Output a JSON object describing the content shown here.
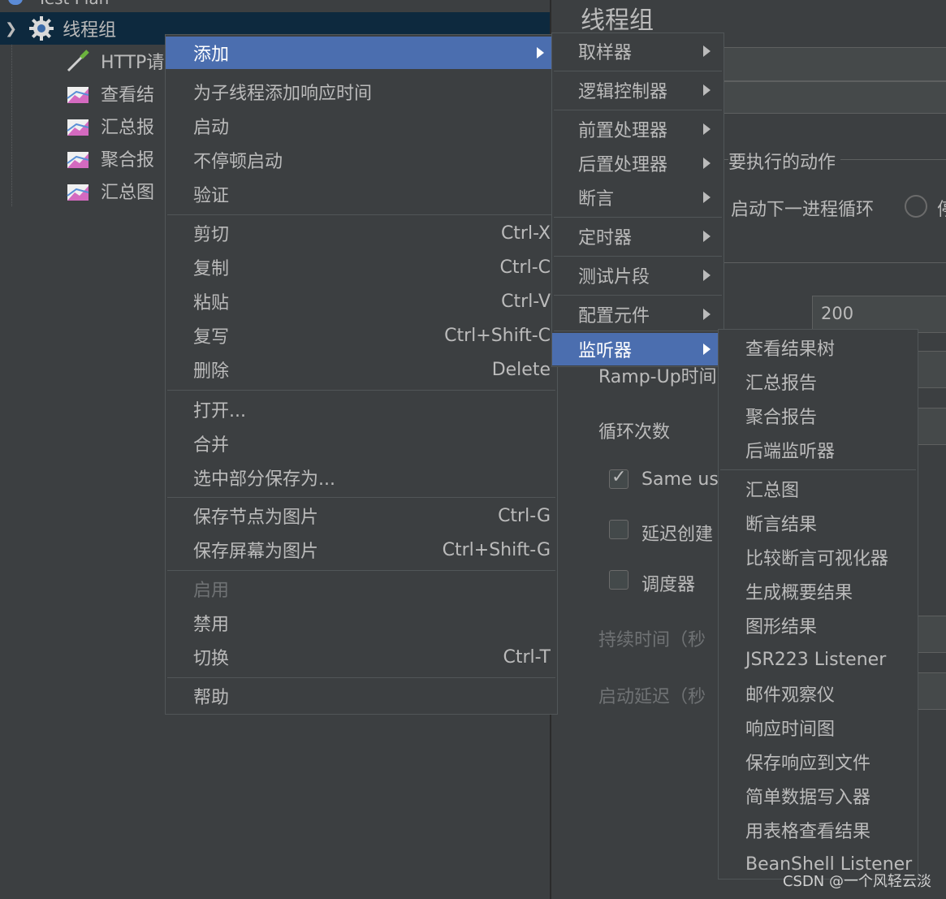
{
  "tree": {
    "top_partial": "Test Plan",
    "thread_group": "线程组",
    "children": [
      "HTTP请",
      "查看结",
      "汇总报",
      "聚合报",
      "汇总图"
    ]
  },
  "panel": {
    "title": "线程组",
    "action_label": "要执行的动作",
    "next_loop_label": "启动下一进程循环",
    "radio_trailing": "停",
    "threads_value": "200",
    "ramp_up_label": "Ramp-Up时间",
    "loop_label": "循环次数",
    "same_user_label": "Same use",
    "delay_create_label": "延迟创建",
    "scheduler_label": "调度器",
    "duration_label": "持续时间（秒",
    "startup_delay_label": "启动延迟（秒"
  },
  "context_menu": {
    "groups": [
      [
        {
          "label": "添加",
          "submenu": true,
          "active": true
        },
        {
          "label": "为子线程添加响应时间"
        },
        {
          "label": "启动"
        },
        {
          "label": "不停顿启动"
        },
        {
          "label": "验证"
        }
      ],
      [
        {
          "label": "剪切",
          "shortcut": "Ctrl-X"
        },
        {
          "label": "复制",
          "shortcut": "Ctrl-C"
        },
        {
          "label": "粘贴",
          "shortcut": "Ctrl-V"
        },
        {
          "label": "复写",
          "shortcut": "Ctrl+Shift-C"
        },
        {
          "label": "删除",
          "shortcut": "Delete"
        }
      ],
      [
        {
          "label": "打开..."
        },
        {
          "label": "合并"
        },
        {
          "label": "选中部分保存为..."
        }
      ],
      [
        {
          "label": "保存节点为图片",
          "shortcut": "Ctrl-G"
        },
        {
          "label": "保存屏幕为图片",
          "shortcut": "Ctrl+Shift-G"
        }
      ],
      [
        {
          "label": "启用",
          "disabled": true
        },
        {
          "label": "禁用"
        },
        {
          "label": "切换",
          "shortcut": "Ctrl-T"
        }
      ],
      [
        {
          "label": "帮助"
        }
      ]
    ]
  },
  "add_submenu": {
    "groups": [
      [
        {
          "label": "取样器"
        }
      ],
      [
        {
          "label": "逻辑控制器"
        }
      ],
      [
        {
          "label": "前置处理器"
        },
        {
          "label": "后置处理器"
        },
        {
          "label": "断言"
        }
      ],
      [
        {
          "label": "定时器"
        }
      ],
      [
        {
          "label": "测试片段"
        }
      ],
      [
        {
          "label": "配置元件"
        }
      ],
      [
        {
          "label": "监听器",
          "active": true
        }
      ]
    ]
  },
  "listener_submenu": {
    "groups": [
      [
        "查看结果树",
        "汇总报告",
        "聚合报告",
        "后端监听器"
      ],
      [
        "汇总图",
        "断言结果",
        "比较断言可视化器",
        "生成概要结果",
        "图形结果",
        "JSR223 Listener",
        "邮件观察仪",
        "响应时间图",
        "保存响应到文件",
        "简单数据写入器",
        "用表格查看结果",
        "BeanShell Listener"
      ]
    ]
  },
  "watermark": "CSDN @一个风轻云淡"
}
